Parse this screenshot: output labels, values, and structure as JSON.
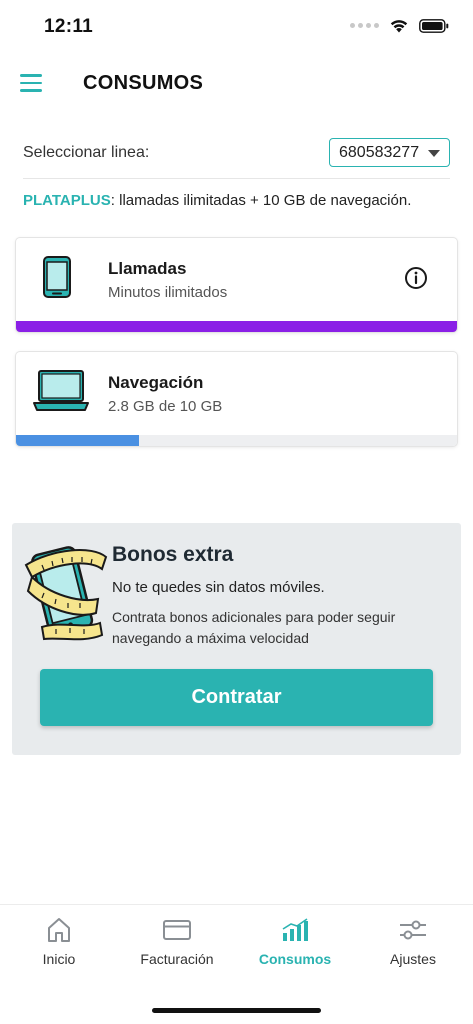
{
  "status_bar": {
    "time": "12:11"
  },
  "header": {
    "title": "CONSUMOS"
  },
  "line_selector": {
    "label": "Seleccionar linea:",
    "selected": "680583277"
  },
  "plan": {
    "name": "PLATAPLUS",
    "description": ": llamadas ilimitadas + 10 GB de navegación."
  },
  "usage": [
    {
      "title": "Llamadas",
      "subtitle": "Minutos ilimitados",
      "fill_fraction": 1.0,
      "color": "#8a1fe6"
    },
    {
      "title": "Navegación",
      "subtitle": "2.8 GB de 10 GB",
      "fill_fraction": 0.28,
      "color": "#4a90e2"
    }
  ],
  "bonus": {
    "title": "Bonos extra",
    "line1": "No te quedes sin datos móviles.",
    "description": "Contrata bonos adicionales para poder seguir navegando a máxima velocidad",
    "button_label": "Contratar"
  },
  "tabs": [
    {
      "label": "Inicio",
      "icon": "home-icon",
      "active": false
    },
    {
      "label": "Facturación",
      "icon": "invoice-icon",
      "active": false
    },
    {
      "label": "Consumos",
      "icon": "bar-chart-icon",
      "active": true
    },
    {
      "label": "Ajustes",
      "icon": "sliders-icon",
      "active": false
    }
  ],
  "colors": {
    "accent": "#2ab3b1",
    "calls_bar": "#8a1fe6",
    "data_bar": "#4a90e2",
    "bonus_bg": "#e8ebed"
  }
}
